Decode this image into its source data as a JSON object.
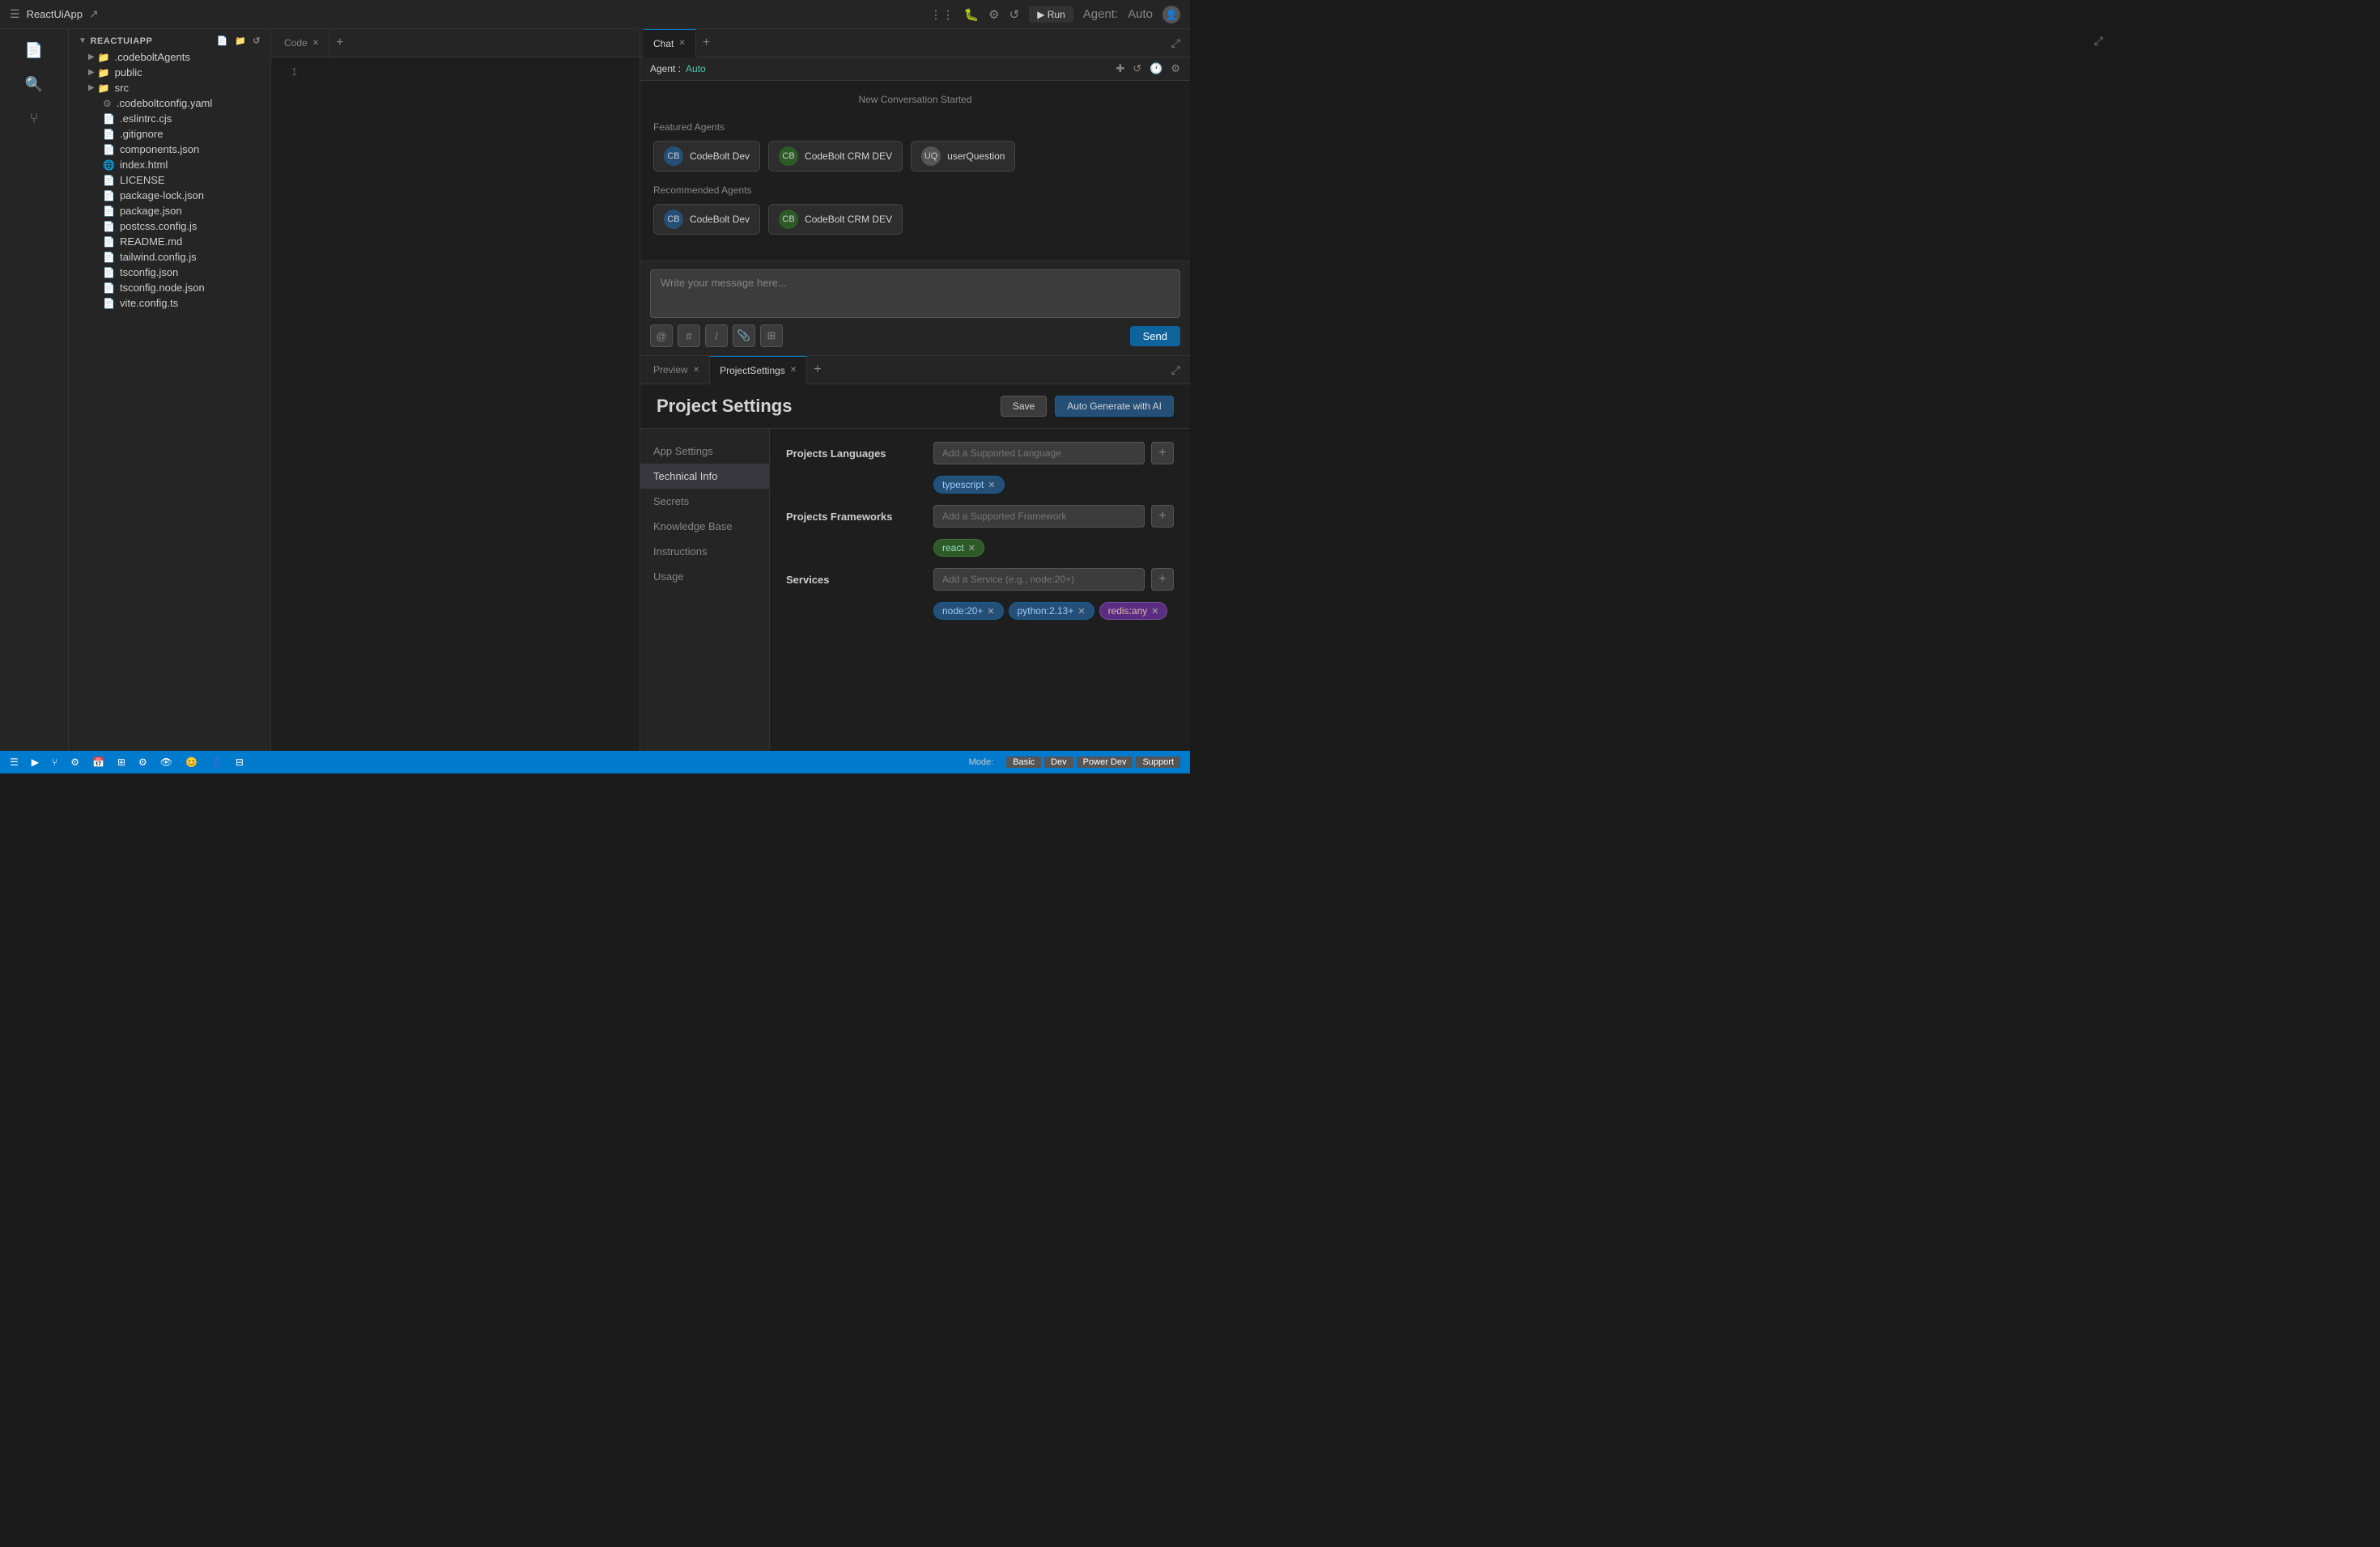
{
  "topbar": {
    "title": "ReactUiApp",
    "external_icon": "⬡",
    "icons": [
      "split-icon",
      "bug-icon",
      "settings-icon",
      "refresh-icon"
    ],
    "run_label": "▶ Run",
    "agent_label": "Agent:",
    "agent_value": "Auto"
  },
  "file_explorer": {
    "root_label": "ReactUiApp",
    "items": [
      {
        "label": ".codeboltAgents",
        "type": "folder",
        "indent": 1
      },
      {
        "label": "public",
        "type": "folder",
        "indent": 1
      },
      {
        "label": "src",
        "type": "folder",
        "indent": 1
      },
      {
        "label": ".codeboltconfig.yaml",
        "type": "file",
        "indent": 1
      },
      {
        "label": ".eslintrc.cjs",
        "type": "file",
        "indent": 1
      },
      {
        "label": ".gitignore",
        "type": "file",
        "indent": 1
      },
      {
        "label": "components.json",
        "type": "file",
        "indent": 1
      },
      {
        "label": "index.html",
        "type": "file",
        "indent": 1
      },
      {
        "label": "LICENSE",
        "type": "file",
        "indent": 1
      },
      {
        "label": "package-lock.json",
        "type": "file",
        "indent": 1
      },
      {
        "label": "package.json",
        "type": "file",
        "indent": 1
      },
      {
        "label": "postcss.config.js",
        "type": "file",
        "indent": 1
      },
      {
        "label": "README.md",
        "type": "file",
        "indent": 1
      },
      {
        "label": "tailwind.config.js",
        "type": "file",
        "indent": 1
      },
      {
        "label": "tsconfig.json",
        "type": "file",
        "indent": 1
      },
      {
        "label": "tsconfig.node.json",
        "type": "file",
        "indent": 1
      },
      {
        "label": "vite.config.ts",
        "type": "file",
        "indent": 1
      }
    ]
  },
  "editor": {
    "line_number": "1"
  },
  "chat": {
    "tab_label": "Chat",
    "agent_label": "Agent :",
    "agent_value": "Auto",
    "new_conv_label": "New Conversation Started",
    "featured_agents_title": "Featured Agents",
    "recommended_agents_title": "Recommended Agents",
    "featured_agents": [
      {
        "name": "CodeBolt Dev",
        "avatar": "CB"
      },
      {
        "name": "CodeBolt CRM DEV",
        "avatar": "CB"
      },
      {
        "name": "userQuestion",
        "avatar": "UQ"
      }
    ],
    "recommended_agents": [
      {
        "name": "CodeBolt Dev",
        "avatar": "CB"
      },
      {
        "name": "CodeBolt CRM DEV",
        "avatar": "CB"
      }
    ],
    "input_placeholder": "Write your message here...",
    "toolbar_icons": [
      "@",
      "#",
      "/",
      "📎",
      "⊞"
    ],
    "send_label": "Send"
  },
  "settings": {
    "preview_tab_label": "Preview",
    "project_settings_tab_label": "ProjectSettings",
    "page_title": "Project Settings",
    "save_label": "Save",
    "auto_generate_label": "Auto Generate with AI",
    "nav_items": [
      {
        "label": "App Settings",
        "active": false
      },
      {
        "label": "Technical Info",
        "active": true
      },
      {
        "label": "Secrets",
        "active": false
      },
      {
        "label": "Knowledge Base",
        "active": false
      },
      {
        "label": "Instructions",
        "active": false
      },
      {
        "label": "Usage",
        "active": false
      }
    ],
    "languages_label": "Projects Languages",
    "languages_placeholder": "Add a Supported Language",
    "language_tags": [
      {
        "label": "typescript",
        "color": "blue"
      }
    ],
    "frameworks_label": "Projects Frameworks",
    "frameworks_placeholder": "Add a Supported Framework",
    "framework_tags": [
      {
        "label": "react",
        "color": "green"
      }
    ],
    "services_label": "Services",
    "services_placeholder": "Add a Service (e.g., node:20+)",
    "service_tags": [
      {
        "label": "node:20+",
        "color": "blue"
      },
      {
        "label": "python:2.13+",
        "color": "blue"
      },
      {
        "label": "redis:any",
        "color": "purple"
      }
    ]
  },
  "statusbar": {
    "left_icons": [
      "file-icon",
      "search-icon",
      "branch-icon"
    ],
    "mode_label": "Mode:",
    "modes": [
      "Basic",
      "Dev",
      "Power Dev",
      "Support"
    ],
    "bottom_icons": [
      "terminal-icon",
      "play-icon",
      "settings-icon",
      "calendar-icon",
      "grid-icon",
      "cog-icon",
      "eye-icon",
      "emoji-icon",
      "person-icon",
      "layout-icon"
    ]
  }
}
